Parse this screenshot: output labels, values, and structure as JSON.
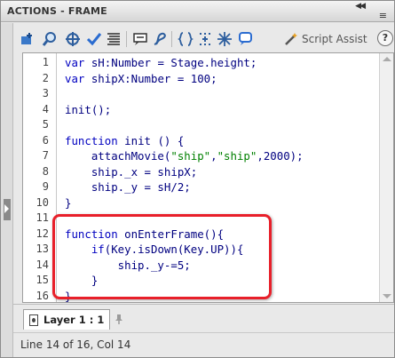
{
  "window": {
    "title": "ACTIONS - FRAME",
    "collapse_glyph": "◀◀",
    "menu_glyph": "≡"
  },
  "toolbar": {
    "buttons": [
      {
        "name": "add-script-item-icon"
      },
      {
        "name": "find-icon"
      },
      {
        "name": "insert-target-path-icon"
      },
      {
        "name": "check-syntax-icon"
      },
      {
        "name": "auto-format-icon"
      },
      {
        "name": "show-code-hint-icon"
      },
      {
        "name": "debug-options-icon"
      },
      {
        "name": "collapse-between-braces-icon"
      },
      {
        "name": "collapse-selection-icon"
      },
      {
        "name": "expand-all-icon"
      },
      {
        "name": "apply-block-comment-icon"
      }
    ],
    "script_assist_label": "Script Assist",
    "help_label": "?"
  },
  "code": {
    "line_numbers": [
      "1",
      "2",
      "3",
      "4",
      "5",
      "6",
      "7",
      "8",
      "9",
      "10",
      "11",
      "12",
      "13",
      "14",
      "15",
      "16"
    ],
    "lines": [
      "var sH:Number = Stage.height;",
      "var shipX:Number = 100;",
      "",
      "init();",
      "",
      "function init () {",
      "    attachMovie(\"ship\",\"ship\",2000);",
      "    ship._x = shipX;",
      "    ship._y = sH/2;",
      "}",
      "",
      "function onEnterFrame(){",
      "    if(Key.isDown(Key.UP)){",
      "        ship._y-=5;",
      "    }",
      "}"
    ]
  },
  "tabs": [
    {
      "label": "Layer 1 : 1"
    }
  ],
  "status": {
    "text": "Line 14 of 16, Col 14"
  },
  "colors": {
    "highlight_border": "#e8202a",
    "code_text": "#000080",
    "keyword": "#0000c0",
    "string": "#008000"
  }
}
